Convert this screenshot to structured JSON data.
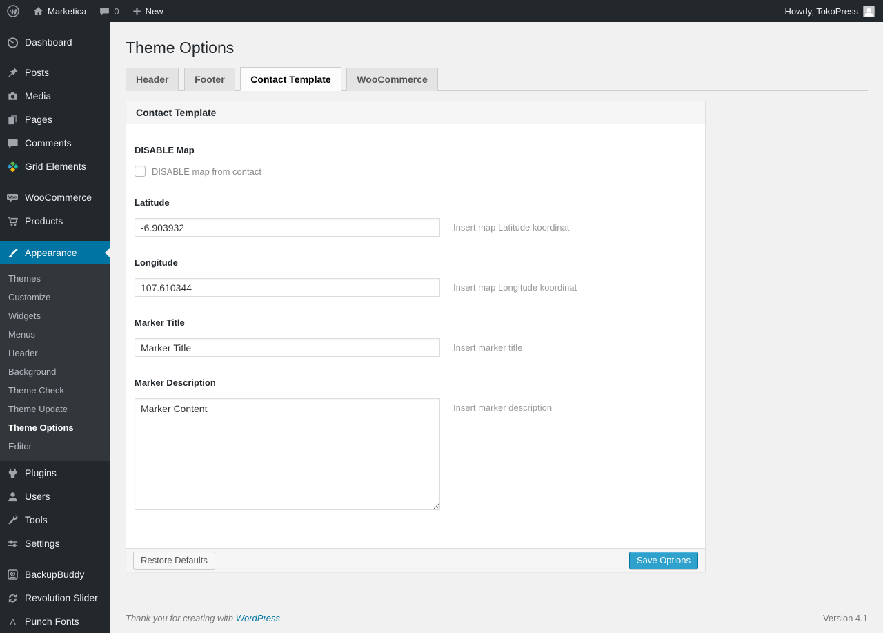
{
  "admin_bar": {
    "site_name": "Marketica",
    "comment_count": "0",
    "new_label": "New",
    "howdy_text": "Howdy, TokoPress"
  },
  "sidebar": {
    "items": [
      {
        "label": "Dashboard"
      },
      {
        "label": "Posts"
      },
      {
        "label": "Media"
      },
      {
        "label": "Pages"
      },
      {
        "label": "Comments"
      },
      {
        "label": "Grid Elements"
      },
      {
        "label": "WooCommerce"
      },
      {
        "label": "Products"
      },
      {
        "label": "Appearance",
        "active": true
      },
      {
        "label": "Plugins"
      },
      {
        "label": "Users"
      },
      {
        "label": "Tools"
      },
      {
        "label": "Settings"
      },
      {
        "label": "BackupBuddy"
      },
      {
        "label": "Revolution Slider"
      },
      {
        "label": "Punch Fonts"
      }
    ],
    "appearance_submenu": [
      {
        "label": "Themes"
      },
      {
        "label": "Customize"
      },
      {
        "label": "Widgets"
      },
      {
        "label": "Menus"
      },
      {
        "label": "Header"
      },
      {
        "label": "Background"
      },
      {
        "label": "Theme Check"
      },
      {
        "label": "Theme Update"
      },
      {
        "label": "Theme Options",
        "current": true
      },
      {
        "label": "Editor"
      }
    ]
  },
  "page": {
    "title": "Theme Options",
    "tabs": [
      {
        "label": "Header",
        "active": false
      },
      {
        "label": "Footer",
        "active": false
      },
      {
        "label": "Contact Template",
        "active": true
      },
      {
        "label": "WooCommerce",
        "active": false
      }
    ]
  },
  "panel": {
    "title": "Contact Template",
    "fields": {
      "disable_map": {
        "label": "DISABLE Map",
        "checkbox_label": "DISABLE map from contact",
        "checked": false
      },
      "latitude": {
        "label": "Latitude",
        "value": "-6.903932",
        "hint": "Insert map Latitude koordinat"
      },
      "longitude": {
        "label": "Longitude",
        "value": "107.610344",
        "hint": "Insert map Longitude koordinat"
      },
      "marker_title": {
        "label": "Marker Title",
        "value": "Marker Title",
        "hint": "Insert marker title"
      },
      "marker_description": {
        "label": "Marker Description",
        "value": "Marker Content",
        "hint": "Insert marker description"
      }
    },
    "restore_button": "Restore Defaults",
    "save_button": "Save Options"
  },
  "footer": {
    "thanks_text": "Thank you for creating with ",
    "wordpress_link": "WordPress",
    "period": ".",
    "version": "Version 4.1"
  },
  "colors": {
    "admin_accent": "#0074a2",
    "button_primary": "#2ea2cc",
    "sidebar_bg": "#23282d",
    "submenu_bg": "#32373c",
    "content_bg": "#f1f1f1"
  }
}
